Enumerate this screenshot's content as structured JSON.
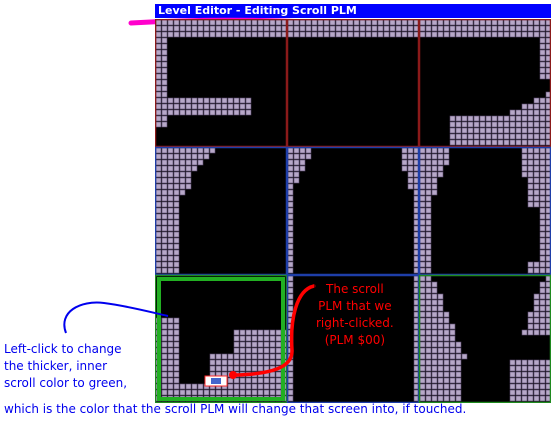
{
  "window": {
    "title": "Level Editor - Editing Scroll PLM"
  },
  "colors": {
    "titlebar": "#0000ff",
    "title_underline": "#ff00cc",
    "scroll_red": "#8b1a1a",
    "scroll_blue": "#1e3ea8",
    "scroll_green": "#1f8a1f",
    "scroll_green_inner": "#22b022",
    "tile": "#b7a8c8",
    "tile_shadow": "#5a4a6e",
    "plm_marker": "#ff2a2a",
    "callout_blue": "#0000ee",
    "callout_red": "#ff0000"
  },
  "screens": [
    {
      "row": 0,
      "col": 0,
      "scroll": "red"
    },
    {
      "row": 0,
      "col": 1,
      "scroll": "red"
    },
    {
      "row": 0,
      "col": 2,
      "scroll": "red"
    },
    {
      "row": 1,
      "col": 0,
      "scroll": "blue"
    },
    {
      "row": 1,
      "col": 1,
      "scroll": "blue"
    },
    {
      "row": 1,
      "col": 2,
      "scroll": "blue"
    },
    {
      "row": 2,
      "col": 0,
      "scroll": "green",
      "selected": true
    },
    {
      "row": 2,
      "col": 1,
      "scroll": "blue"
    },
    {
      "row": 2,
      "col": 2,
      "scroll": "green"
    }
  ],
  "annotations": {
    "left_lines": [
      "Left-click to change",
      "the thicker, inner",
      "scroll color to green,"
    ],
    "bottom_line": "which is the color that the scroll PLM will change that screen into, if touched.",
    "plm_lines": [
      "The scroll",
      "PLM that we",
      "right-clicked.",
      "(PLM $00)"
    ]
  },
  "icons": {
    "blue_arrow": "curved-arrow-icon",
    "red_arrow": "curved-arrow-icon",
    "plm": "scroll-plm-icon"
  }
}
